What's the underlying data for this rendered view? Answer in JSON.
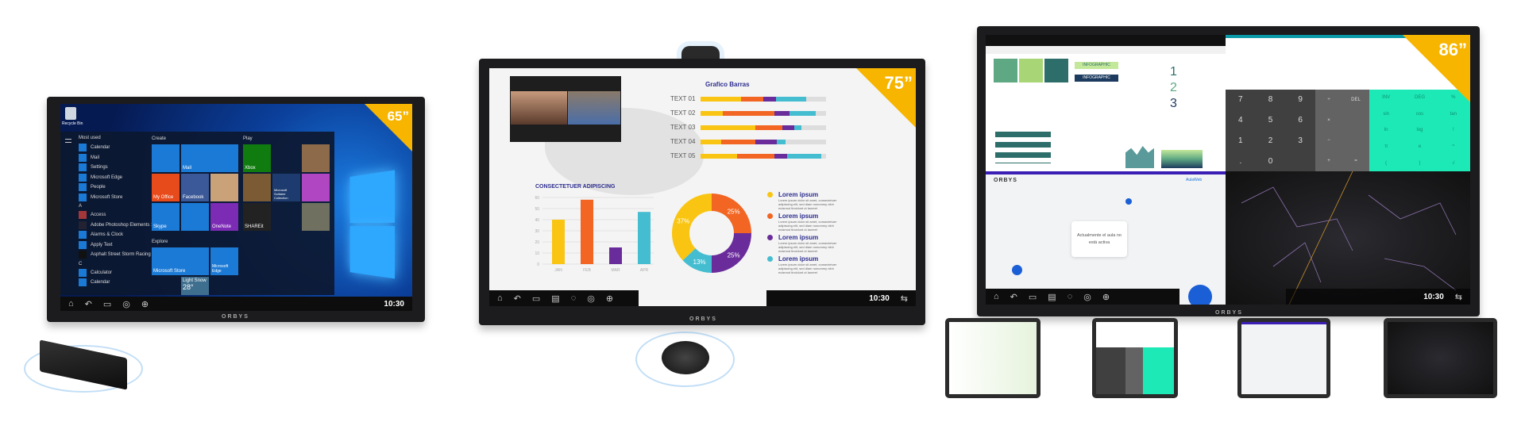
{
  "brand": "ORBYS",
  "accent": "#f7b500",
  "clock": "10:30",
  "display_65": {
    "size_label": "65”",
    "recycle_bin": "Recycle Bin",
    "menu_header": "Most used",
    "menu_items": [
      "Calendar",
      "Mail",
      "Settings",
      "Microsoft Edge",
      "People",
      "Microsoft Store"
    ],
    "section_a": "A",
    "a_items": [
      "Access",
      "Adobe Photoshop Elements 15",
      "Alarms & Clock",
      "Apply Text",
      "Asphalt Street Storm Racing"
    ],
    "section_c": "C",
    "c_items": [
      "Calculator",
      "Calendar"
    ],
    "groups": {
      "create": "Create",
      "play": "Play",
      "explore": "Explore"
    },
    "tiles": {
      "mail": "Mail",
      "office": "My Office",
      "facebook": "Facebook",
      "skype": "Skype",
      "onenote": "OneNote",
      "xbox": "Xbox",
      "shareit": "SHAREit",
      "solitaire": "Microsoft Solitaire Collection",
      "store": "Microsoft Store",
      "edge": "Microsoft Edge",
      "weather": "Light Snow",
      "temp": "28°"
    }
  },
  "display_75": {
    "size_label": "75”",
    "bars_title": "Grafico Barras",
    "stacked_rows": [
      {
        "label": "TEXT 01",
        "segments": [
          0.325,
          0.175,
          0.1,
          0.245
        ]
      },
      {
        "label": "TEXT 02",
        "segments": [
          0.18,
          0.41,
          0.12,
          0.21
        ]
      },
      {
        "label": "TEXT 03",
        "segments": [
          0.435,
          0.22,
          0.09,
          0.06
        ]
      },
      {
        "label": "TEXT 04",
        "segments": [
          0.165,
          0.27,
          0.17,
          0.07
        ]
      },
      {
        "label": "TEXT 05",
        "segments": [
          0.29,
          0.3,
          0.1,
          0.27
        ]
      }
    ],
    "segment_colors": [
      "#f9c512",
      "#f26522",
      "#6a2c9b",
      "#45bdd0"
    ],
    "column_chart": {
      "title": "CONSECTETUER ADIPISCING",
      "categories": [
        "JAN",
        "FEB",
        "MAR",
        "APR"
      ],
      "values": [
        40,
        58,
        15,
        47
      ],
      "yticks": [
        "0",
        "10",
        "20",
        "30",
        "40",
        "50",
        "60"
      ],
      "ylim": [
        0,
        60
      ]
    },
    "donut": {
      "values": [
        25,
        25,
        13,
        37
      ],
      "labels": [
        "25%",
        "25%",
        "13%",
        "37%"
      ]
    },
    "legend": [
      {
        "title": "Lorem ipsum",
        "text": "Lorem ipsum dolor sit amet, consectetuer adipiscing elit, sed diam nonummy nibh euismod tincidunt ut laoreet"
      },
      {
        "title": "Lorem ipsum",
        "text": "Lorem ipsum dolor sit amet, consectetuer adipiscing elit, sed diam nonummy nibh euismod tincidunt ut laoreet"
      },
      {
        "title": "Lorem ipsum",
        "text": "Lorem ipsum dolor sit amet, consectetuer adipiscing elit, sed diam nonummy nibh euismod tincidunt ut laoreet"
      },
      {
        "title": "Lorem ipsum",
        "text": "Lorem ipsum dolor sit amet, consectetuer adipiscing elit, sed diam nonummy nibh euismod tincidunt ut laoreet"
      }
    ]
  },
  "display_86": {
    "size_label": "86”",
    "infographic_1": "INFOGRAPHIC",
    "infographic_2": "INFOGRAPHIC",
    "numbers": [
      "1",
      "2",
      "3"
    ],
    "calc_keys": [
      "7",
      "8",
      "9",
      "4",
      "5",
      "6",
      "1",
      "2",
      "3",
      ".",
      "0",
      ""
    ],
    "calc_ops": [
      "÷",
      "DEL",
      "×",
      "",
      "−",
      "",
      "+",
      "="
    ],
    "sci_keys": [
      "INV",
      "DEG",
      "%",
      "sin",
      "cos",
      "tan",
      "ln",
      "log",
      "!",
      "π",
      "e",
      "^",
      "(",
      ")",
      "√"
    ],
    "classroom_brand": "ORBYS",
    "classroom_app": "AulaWeb",
    "classroom_message": "Actualmente el aula no está activa"
  }
}
